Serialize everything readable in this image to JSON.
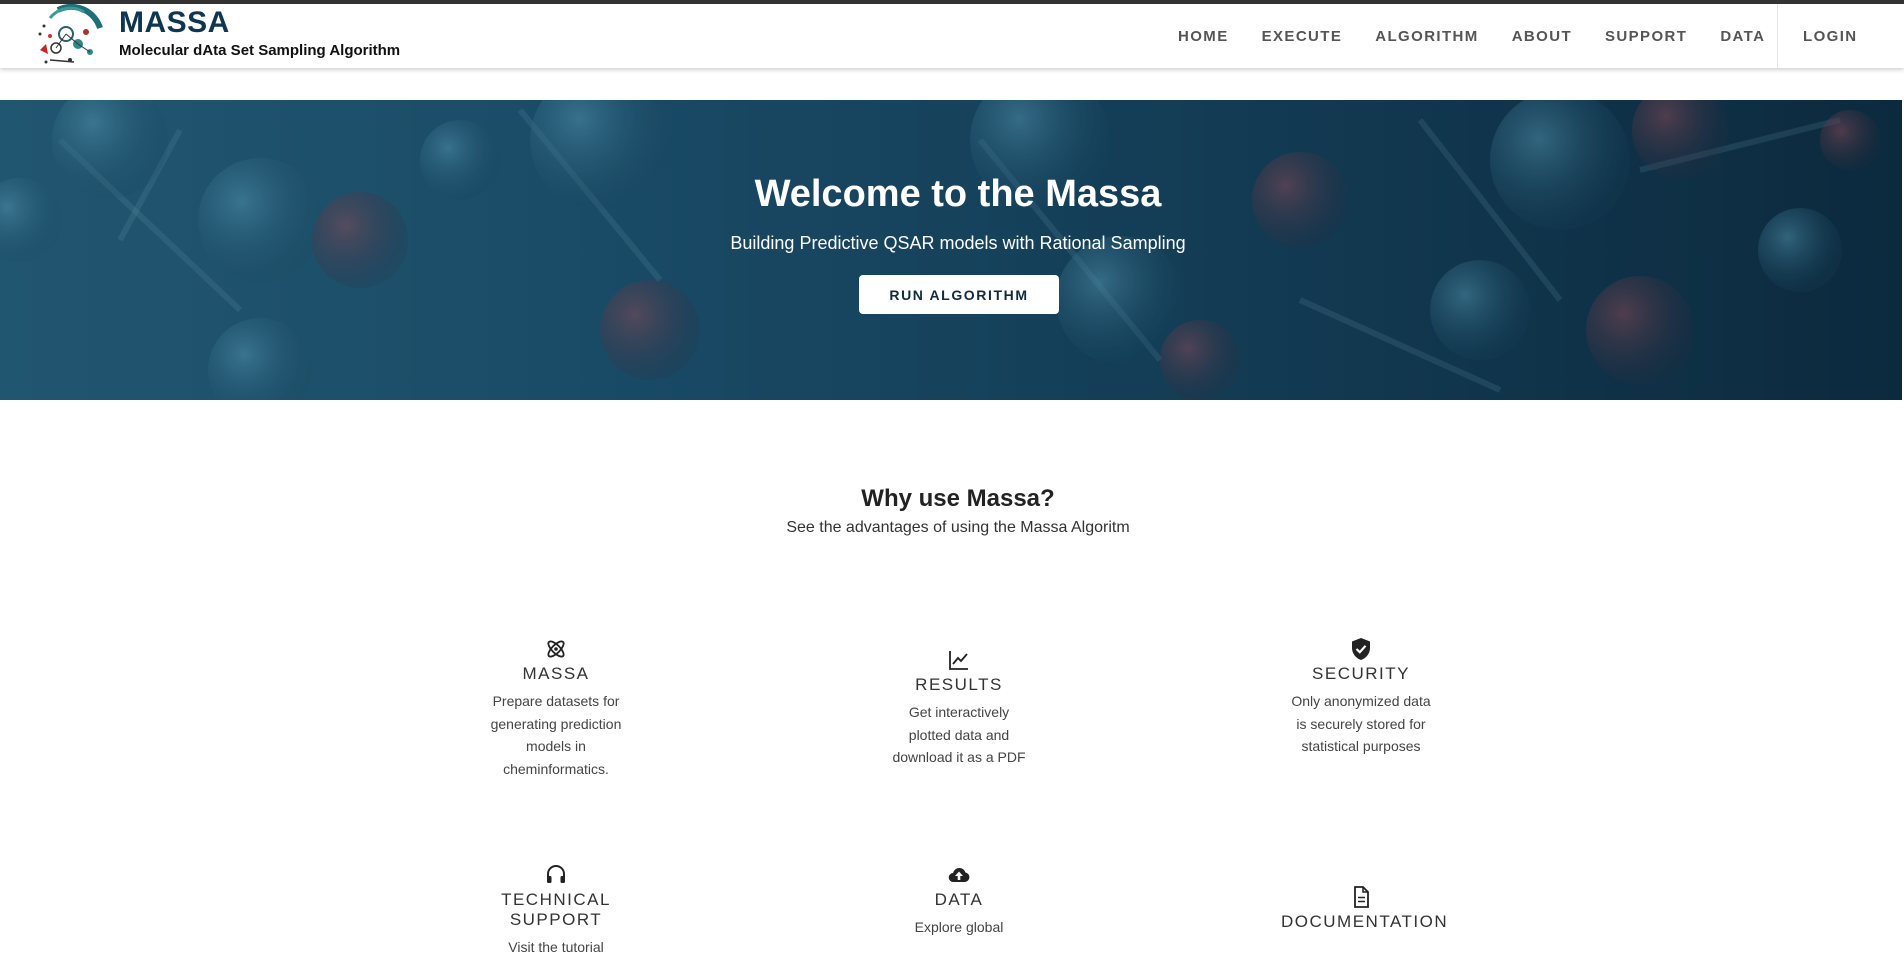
{
  "header": {
    "logo_icon": "massa-logo-icon",
    "title": "MASSA",
    "subtitle": "Molecular dAta Set Sampling Algorithm",
    "menu": [
      {
        "label": "HOME"
      },
      {
        "label": "EXECUTE"
      },
      {
        "label": "ALGORITHM"
      },
      {
        "label": "ABOUT"
      },
      {
        "label": "SUPPORT"
      },
      {
        "label": "DATA"
      }
    ],
    "login_label": "LOGIN"
  },
  "hero": {
    "title": "Welcome to the Massa",
    "subtitle": "Building Predictive QSAR models with Rational Sampling",
    "button_label": "RUN ALGORITHM"
  },
  "why": {
    "title": "Why use Massa?",
    "subtitle": "See the advantages of using the Massa Algoritm"
  },
  "features": [
    {
      "icon": "atom-icon",
      "title": "MASSA",
      "text": "Prepare datasets for generating prediction models in cheminformatics."
    },
    {
      "icon": "line-chart-icon",
      "title": "RESULTS",
      "text": "Get interactively plotted data and download it as a PDF"
    },
    {
      "icon": "shield-check-icon",
      "title": "SECURITY",
      "text": "Only anonymized data is securely stored for statistical purposes"
    },
    {
      "icon": "headset-icon",
      "title": "TECHNICAL SUPPORT",
      "text": "Visit the tutorial"
    },
    {
      "icon": "cloud-upload-icon",
      "title": "DATA",
      "text": "Explore global"
    },
    {
      "icon": "document-icon",
      "title": "DOCUMENTATION",
      "text": ""
    }
  ],
  "colors": {
    "brand": "#0f3650",
    "hero_dark": "#0d2b40",
    "hero_light": "#27617d",
    "nav_text": "#555555"
  }
}
